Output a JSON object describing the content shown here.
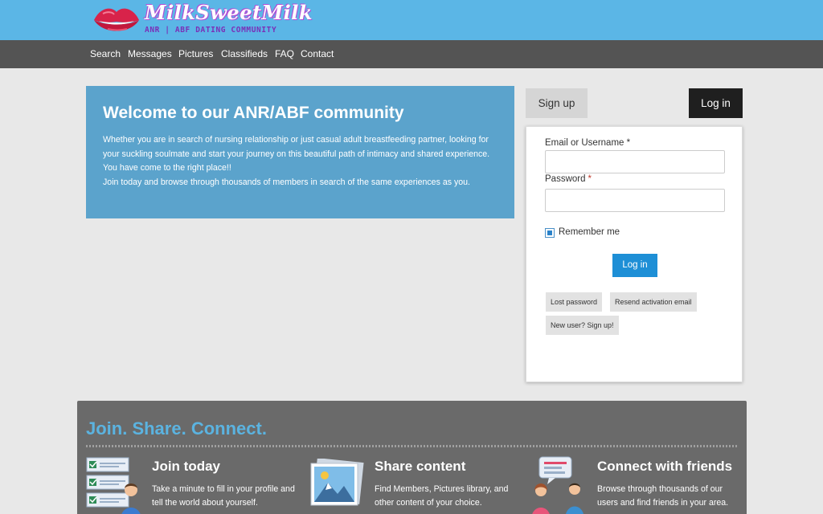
{
  "brand": {
    "logo_text": "MilkSweetMilk",
    "tagline": "ANR | ABF DATING COMMUNITY"
  },
  "nav": [
    {
      "label": "Search"
    },
    {
      "label": "Messages"
    },
    {
      "label": "Pictures"
    },
    {
      "label": "Classifieds"
    },
    {
      "label": "FAQ"
    },
    {
      "label": "Contact"
    }
  ],
  "welcome": {
    "title": "Welcome to our ANR/ABF community",
    "paragraph1": "Whether you are in search of nursing relationship or just casual adult breastfeeding partner, looking for your suckling soulmate and start your journey on this beautiful path of intimacy and shared experience. You have come to the right place!!",
    "paragraph2": "Join today and browse through thousands of members in search of the same experiences as you."
  },
  "auth_tabs": {
    "signup": "Sign up",
    "login": "Log in"
  },
  "login_form": {
    "username_label": "Email or Username",
    "username_value": "",
    "password_label": "Password",
    "password_value": "",
    "required_mark": "*",
    "remember_label": "Remember me",
    "remember_checked": true,
    "submit_label": "Log in",
    "links": {
      "lost_password": "Lost password",
      "resend_activation": "Resend activation email",
      "new_user": "New user? Sign up!"
    }
  },
  "features": {
    "heading": "Join. Share. Connect.",
    "columns": [
      {
        "icon": "checklist-person-icon",
        "title": "Join today",
        "text": "Take a minute to fill in your profile and tell the world about yourself."
      },
      {
        "icon": "picture-icon",
        "title": "Share content",
        "text": "Find Members, Pictures library, and other content of your choice."
      },
      {
        "icon": "chat-people-icon",
        "title": "Connect with friends",
        "text": "Browse through thousands of our users and find friends in your area."
      }
    ]
  },
  "colors": {
    "header_bg": "#5bb6e6",
    "nav_bg": "#545454",
    "welcome_bg": "#5ba3cc",
    "primary_button": "#1e8fd6",
    "feature_bg": "#6a6a6a",
    "feature_heading": "#5bb3e0"
  }
}
